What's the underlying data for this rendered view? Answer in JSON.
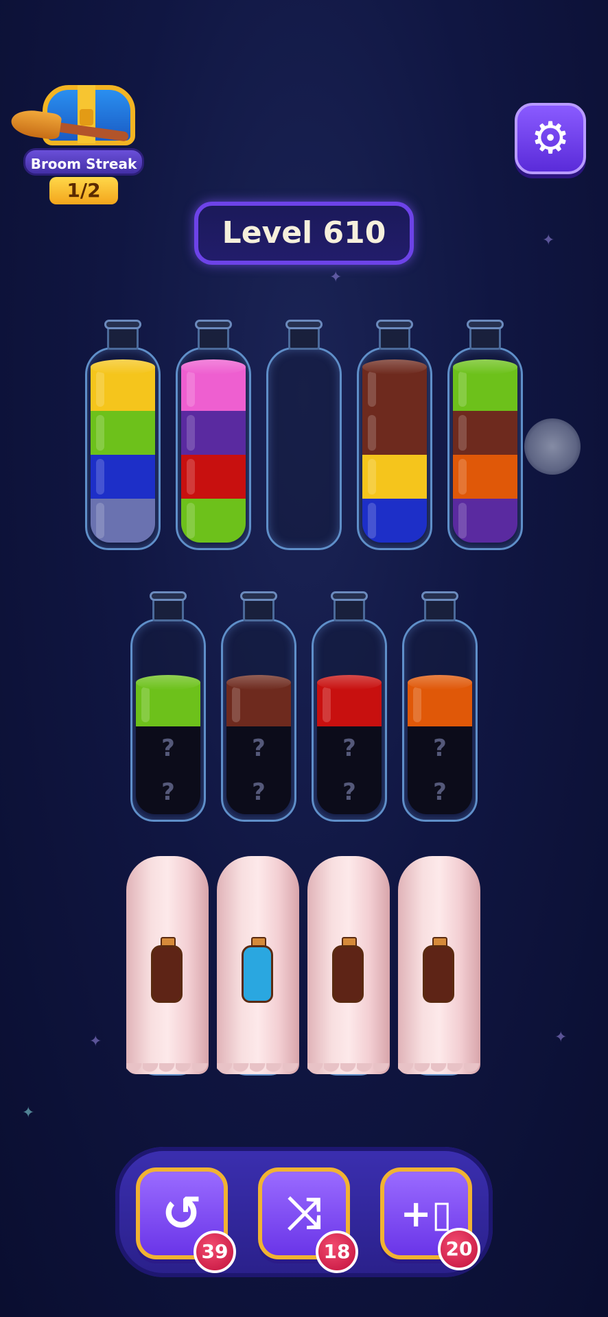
{
  "header": {
    "streak_title": "Broom Streak",
    "streak_count": "1/2",
    "level_label": "Level 610",
    "settings_icon": "gear-icon"
  },
  "colors": {
    "yellow": "#f5c51c",
    "green": "#6dc11b",
    "blue": "#1d2fc8",
    "slate": "#6a72b0",
    "pink": "#ee5fd0",
    "purple": "#5a2aa0",
    "red": "#c8100f",
    "brown": "#6e2a1e",
    "orange": "#e05808"
  },
  "rows": [
    {
      "bottles": [
        {
          "layers_bottom_to_top": [
            "slate",
            "blue",
            "green",
            "yellow"
          ]
        },
        {
          "layers_bottom_to_top": [
            "green",
            "red",
            "purple",
            "pink"
          ]
        },
        {
          "layers_bottom_to_top": []
        },
        {
          "layers_bottom_to_top": [
            "blue",
            "yellow",
            "brown",
            "brown"
          ]
        },
        {
          "layers_bottom_to_top": [
            "purple",
            "orange",
            "brown",
            "green"
          ]
        }
      ]
    },
    {
      "bottles": [
        {
          "hidden": 2,
          "visible_top": [
            "green"
          ],
          "hidden_symbol": "?"
        },
        {
          "hidden": 2,
          "visible_top": [
            "brown"
          ],
          "hidden_symbol": "?"
        },
        {
          "hidden": 2,
          "visible_top": [
            "red"
          ],
          "hidden_symbol": "?"
        },
        {
          "hidden": 2,
          "visible_top": [
            "orange"
          ],
          "hidden_symbol": "?"
        }
      ]
    }
  ],
  "covered_bottles": [
    {
      "hint_color": "#5e2416"
    },
    {
      "hint_color": "#2aa7e0"
    },
    {
      "hint_color": "#5e2416"
    },
    {
      "hint_color": "#5e2416"
    }
  ],
  "toolbar": {
    "undo": {
      "icon": "undo-icon",
      "count": "39"
    },
    "shuffle": {
      "icon": "shuffle-icon",
      "count": "18"
    },
    "add_bottle": {
      "icon": "add-bottle-icon",
      "count": "20"
    }
  }
}
